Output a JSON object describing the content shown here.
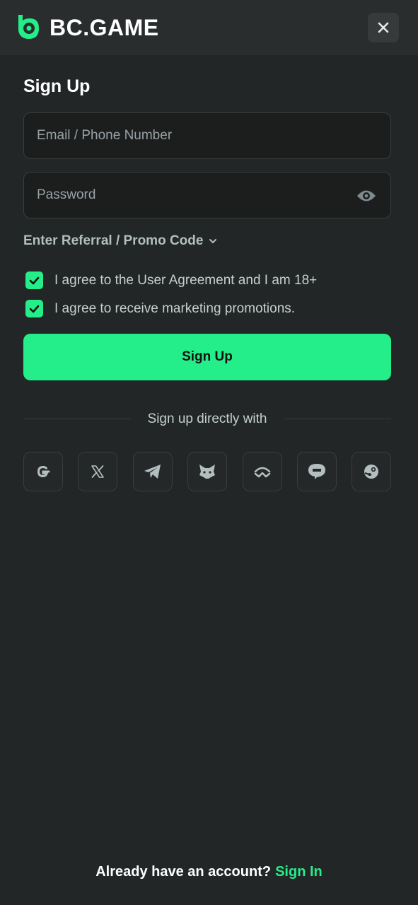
{
  "header": {
    "brand": "BC.GAME",
    "logo_icon": "bc-game-logo-icon",
    "close_icon": "close-icon"
  },
  "form": {
    "title": "Sign Up",
    "email_placeholder": "Email / Phone Number",
    "password_placeholder": "Password",
    "password_toggle_icon": "eye-icon",
    "referral_label": "Enter Referral / Promo Code",
    "agreements": [
      {
        "label": "I agree to the User Agreement and I am 18+",
        "checked": true
      },
      {
        "label": "I agree to receive marketing promotions.",
        "checked": true
      }
    ],
    "submit_label": "Sign Up"
  },
  "social": {
    "heading": "Sign up directly with",
    "providers": [
      "google-icon",
      "x-icon",
      "telegram-icon",
      "metamask-icon",
      "walletconnect-icon",
      "line-icon",
      "steam-icon"
    ]
  },
  "footer": {
    "prompt": "Already have an account?",
    "link": "Sign In"
  },
  "colors": {
    "accent": "#24ee89",
    "background": "#232626",
    "header": "#2a2d2e"
  }
}
